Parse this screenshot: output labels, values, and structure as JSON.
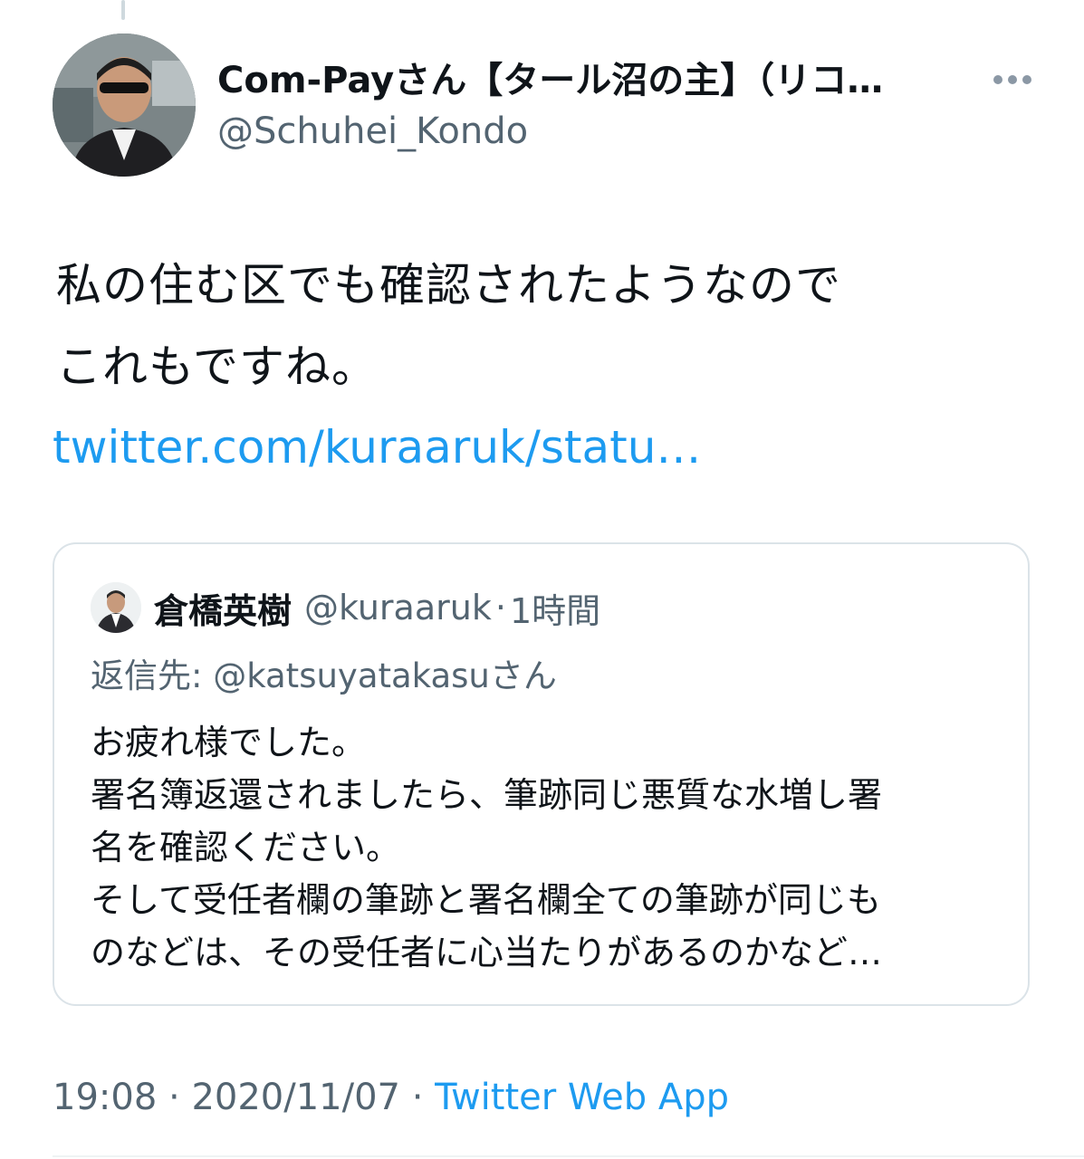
{
  "author": {
    "display_name": "Com-Payさん【タール沼の主】（リコ…",
    "handle": "@Schuhei_Kondo"
  },
  "tweet": {
    "text_lines": [
      "私の住む区でも確認されたようなので",
      "これもですね。"
    ],
    "link_text": "twitter.com/kuraaruk/statu…"
  },
  "quote": {
    "name": "倉橋英樹",
    "handle": "@kuraaruk",
    "separator": "·",
    "time": "1時間",
    "reply_label": "返信先: ",
    "reply_mention": "@katsuyatakasuさん",
    "text_lines": [
      "お疲れ様でした。",
      "署名簿返還されましたら、筆跡同じ悪質な水増し署",
      "名を確認ください。",
      "そして受任者欄の筆跡と署名欄全ての筆跡が同じも",
      "のなどは、その受任者に心当たりがあるのかなど…"
    ]
  },
  "meta": {
    "time": "19:08",
    "separator": " · ",
    "date": "2020/11/07",
    "source": "Twitter Web App"
  },
  "icons": {
    "more": "more-horizontal-icon",
    "author_avatar": "avatar-photo",
    "quote_avatar": "avatar-photo"
  },
  "colors": {
    "link": "#1d9bf0",
    "secondary_text": "#536471",
    "primary_text": "#0f1419",
    "card_border": "#dbe3e8"
  }
}
